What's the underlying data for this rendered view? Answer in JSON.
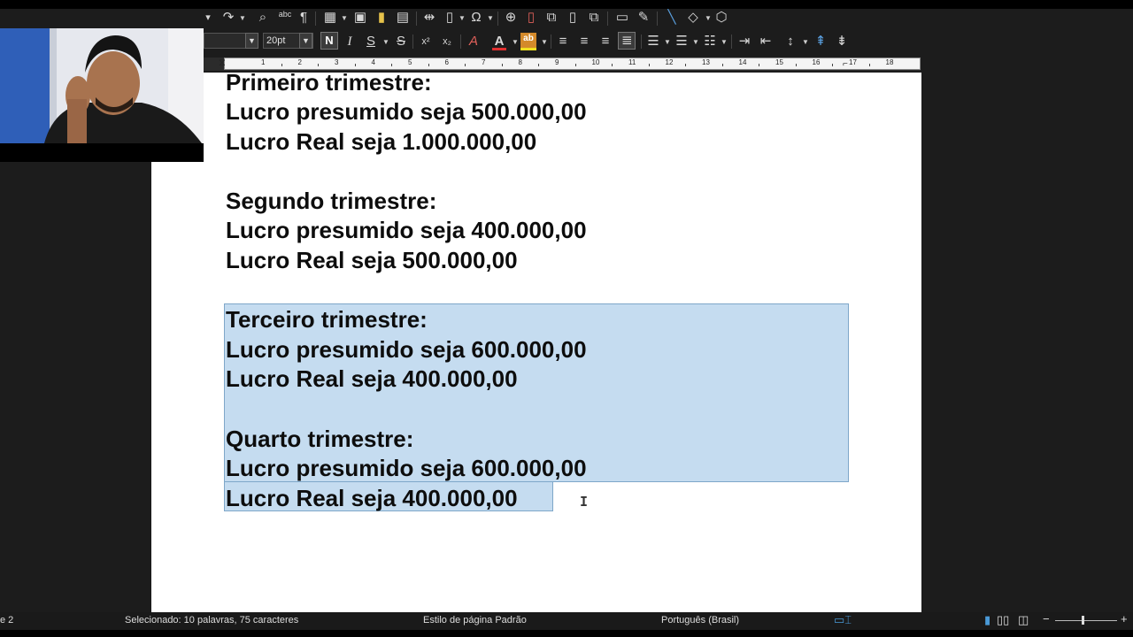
{
  "toolbar": {
    "font_size": "20pt",
    "bold": "N",
    "italic": "I",
    "underline": "S",
    "strike": "S",
    "superscript": "x²",
    "subscript": "x₂",
    "spellcheck": "abc",
    "pilcrow": "¶",
    "omega": "Ω",
    "font_color_letter": "A",
    "highlight_letters": "ab"
  },
  "ruler": {
    "numbers": [
      "1",
      "2",
      "3",
      "4",
      "5",
      "6",
      "7",
      "8",
      "9",
      "10",
      "11",
      "12",
      "13",
      "14",
      "15",
      "16",
      "17",
      "18"
    ]
  },
  "document": {
    "lines": [
      "Primeiro trimestre:",
      "Lucro presumido seja 500.000,00",
      "Lucro Real seja 1.000.000,00",
      "Segundo trimestre:",
      "Lucro presumido seja 400.000,00",
      "Lucro Real seja 500.000,00",
      "Terceiro trimestre:",
      "Lucro presumido seja 600.000,00",
      "Lucro Real seja 400.000,00",
      "Quarto trimestre:",
      "Lucro presumido seja 600.000,00",
      "Lucro Real seja 400.000,00"
    ]
  },
  "status": {
    "page": "e 2",
    "selection": "Selecionado: 10 palavras, 75 caracteres",
    "page_style": "Estilo de página Padrão",
    "language": "Português (Brasil)"
  },
  "colors": {
    "selection": "#c5dcf0",
    "background": "#1c1c1c"
  }
}
